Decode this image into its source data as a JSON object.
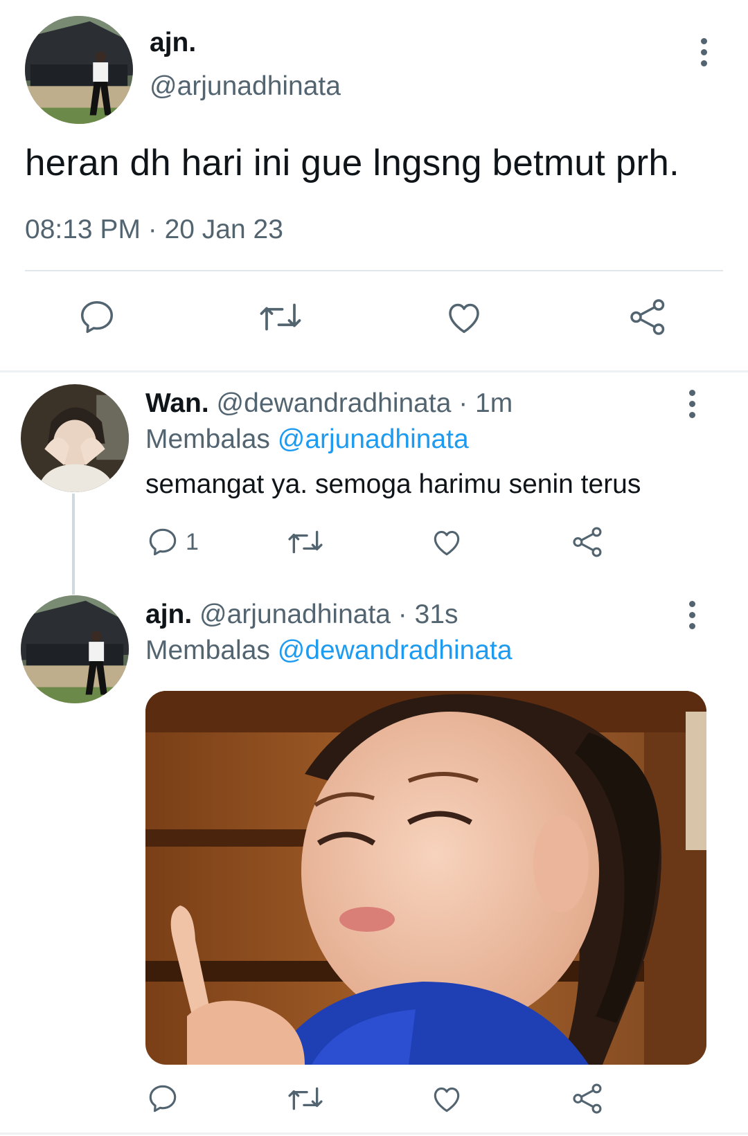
{
  "main_tweet": {
    "display_name": "ajn.",
    "handle": "@arjunadhinata",
    "text": "heran dh hari ini gue lngsng betmut prh.",
    "timestamp": "08:13 PM · 20 Jan 23",
    "actions": {
      "reply_icon": "reply-icon",
      "retweet_icon": "retweet-icon",
      "like_icon": "like-icon",
      "share_icon": "share-icon"
    }
  },
  "replies": [
    {
      "display_name": "Wan.",
      "handle_time": " @dewandradhinata · 1m",
      "replying_label": "Membalas ",
      "replying_to": "@arjunadhinata",
      "text": "semangat ya. semoga harimu senin terus",
      "reply_count": "1"
    },
    {
      "display_name": "ajn.",
      "handle_time": " @arjunadhinata · 31s",
      "replying_label": "Membalas ",
      "replying_to": "@dewandradhinata",
      "text": "",
      "media": "gif"
    }
  ],
  "colors": {
    "text_primary": "#0f1419",
    "text_secondary": "#536471",
    "accent": "#1d9bf0",
    "divider": "#e1e6ea"
  }
}
